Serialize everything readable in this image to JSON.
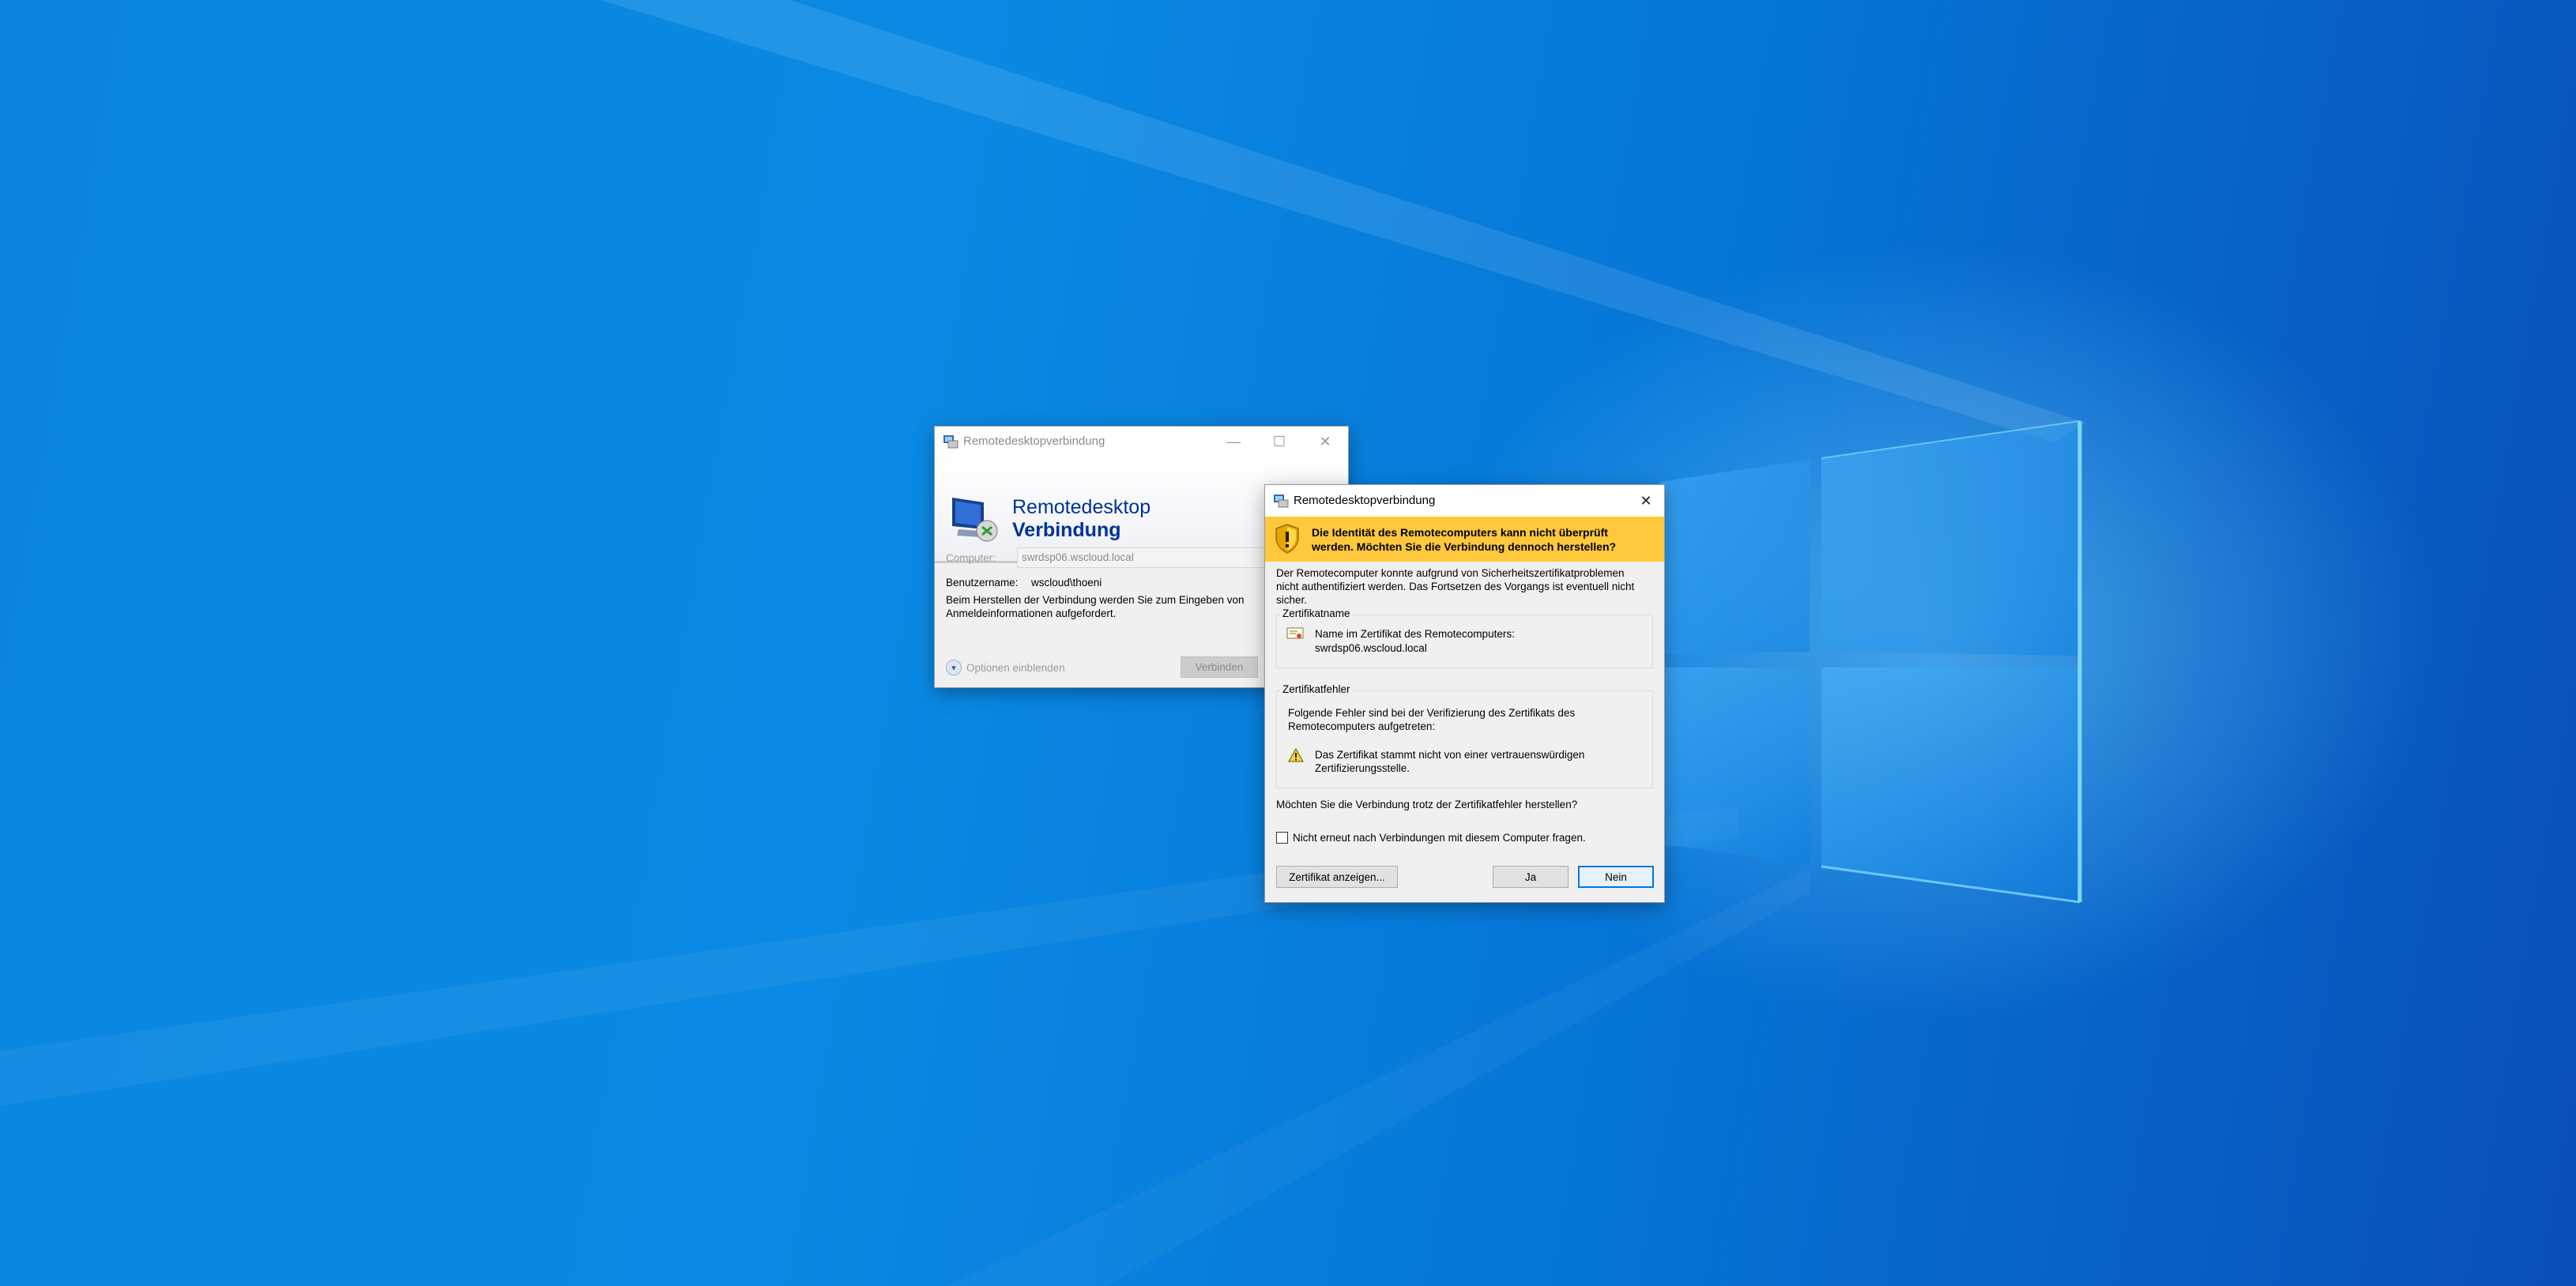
{
  "main_window": {
    "title": "Remotedesktopverbindung",
    "banner_line1": "Remotedesktop",
    "banner_line2": "Verbindung",
    "computer_label": "Computer:",
    "computer_value": "swrdsp06.wscloud.local",
    "username_label": "Benutzername:",
    "username_value": "wscloud\\thoeni",
    "info_text_line1": "Beim Herstellen der Verbindung werden Sie zum Eingeben von",
    "info_text_line2": "Anmeldeinformationen aufgefordert.",
    "options_label": "Optionen einblenden",
    "connect_label": "Verbinden",
    "minimize_glyph": "—",
    "maximize_glyph": "☐",
    "close_glyph": "✕"
  },
  "dialog": {
    "title": "Remotedesktopverbindung",
    "close_glyph": "✕",
    "warning_line1": "Die Identität des Remotecomputers kann nicht überprüft",
    "warning_line2": "werden. Möchten Sie die Verbindung dennoch herstellen?",
    "desc_line1": "Der Remotecomputer konnte aufgrund von Sicherheitszertifikatproblemen",
    "desc_line2": "nicht authentifiziert werden. Das Fortsetzen des Vorgangs ist eventuell nicht",
    "desc_line3": "sicher.",
    "cert_name_group": "Zertifikatname",
    "cert_name_label": "Name im Zertifikat des Remotecomputers:",
    "cert_name_value": "swrdsp06.wscloud.local",
    "cert_error_group": "Zertifikatfehler",
    "error_intro_line1": "Folgende Fehler sind bei der Verifizierung des Zertifikats des",
    "error_intro_line2": "Remotecomputers aufgetreten:",
    "error_item_line1": "Das Zertifikat stammt nicht von einer vertrauenswürdigen",
    "error_item_line2": "Zertifizierungsstelle.",
    "question": "Möchten Sie die Verbindung trotz der Zertifikatfehler herstellen?",
    "checkbox_label": "Nicht erneut nach Verbindungen mit diesem Computer fragen.",
    "checkbox_checked": false,
    "view_cert_label": "Zertifikat anzeigen...",
    "yes_label": "Ja",
    "no_label": "Nein"
  },
  "colors": {
    "warning_banner": "#ffc83d",
    "accent_blue": "#0078d7",
    "banner_title": "#003399"
  }
}
